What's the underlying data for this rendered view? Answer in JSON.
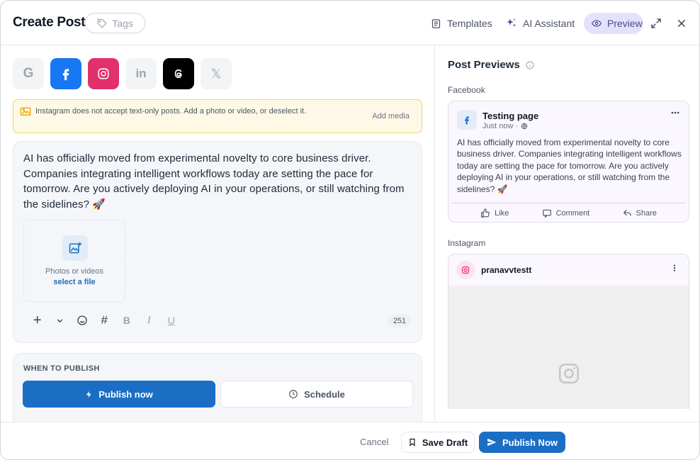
{
  "header": {
    "title": "Create Post",
    "tags_label": "Tags",
    "templates_label": "Templates",
    "ai_assistant_label": "AI Assistant",
    "preview_label": "Preview"
  },
  "platforms": [
    {
      "name": "Google",
      "glyph": "G",
      "selected": false,
      "color": "#9ca3af"
    },
    {
      "name": "Facebook",
      "glyph": "f",
      "selected": true,
      "color": "#1877f2"
    },
    {
      "name": "Instagram",
      "selected": true,
      "color": "#e1306c"
    },
    {
      "name": "LinkedIn",
      "glyph": "in",
      "selected": false,
      "color": "#9ca3af"
    },
    {
      "name": "Threads",
      "selected": true,
      "color": "#000000"
    },
    {
      "name": "X",
      "glyph": "𝕏",
      "selected": false,
      "color": "#9ca3af"
    }
  ],
  "warning": {
    "text": "Instagram does not accept text-only posts. Add a photo or video, or deselect it.",
    "action": "Add media"
  },
  "composer": {
    "text": "AI has officially moved from experimental novelty to core business driver. Companies integrating intelligent workflows today are setting the pace for tomorrow. Are you actively deploying AI in your operations, or still watching from the sidelines? 🚀",
    "media_label": "Photos or videos",
    "media_link": "select a file",
    "char_count": "251",
    "toolbar": {
      "bold": "B",
      "italic": "I",
      "underline": "U",
      "hashtag": "#",
      "add": "+"
    }
  },
  "publish": {
    "section_label": "WHEN TO PUBLISH",
    "publish_now": "Publish now",
    "schedule": "Schedule"
  },
  "previews": {
    "title": "Post Previews",
    "facebook": {
      "section_label": "Facebook",
      "page_name": "Testing page",
      "time": "Just now ·",
      "text": "AI has officially moved from experimental novelty to core business driver. Companies integrating intelligent workflows today are setting the pace for tomorrow. Are you actively deploying AI in your operations, or still watching from the sidelines? 🚀",
      "like": "Like",
      "comment": "Comment",
      "share": "Share"
    },
    "instagram": {
      "section_label": "Instagram",
      "username": "pranavvtestt"
    }
  },
  "footer": {
    "cancel": "Cancel",
    "save_draft": "Save Draft",
    "publish_now": "Publish Now"
  },
  "colors": {
    "accent": "#1a6fc4",
    "preview_bg": "#e4e1fb",
    "warning_bg": "#fdf9e6",
    "warning_border": "#f2d764"
  }
}
